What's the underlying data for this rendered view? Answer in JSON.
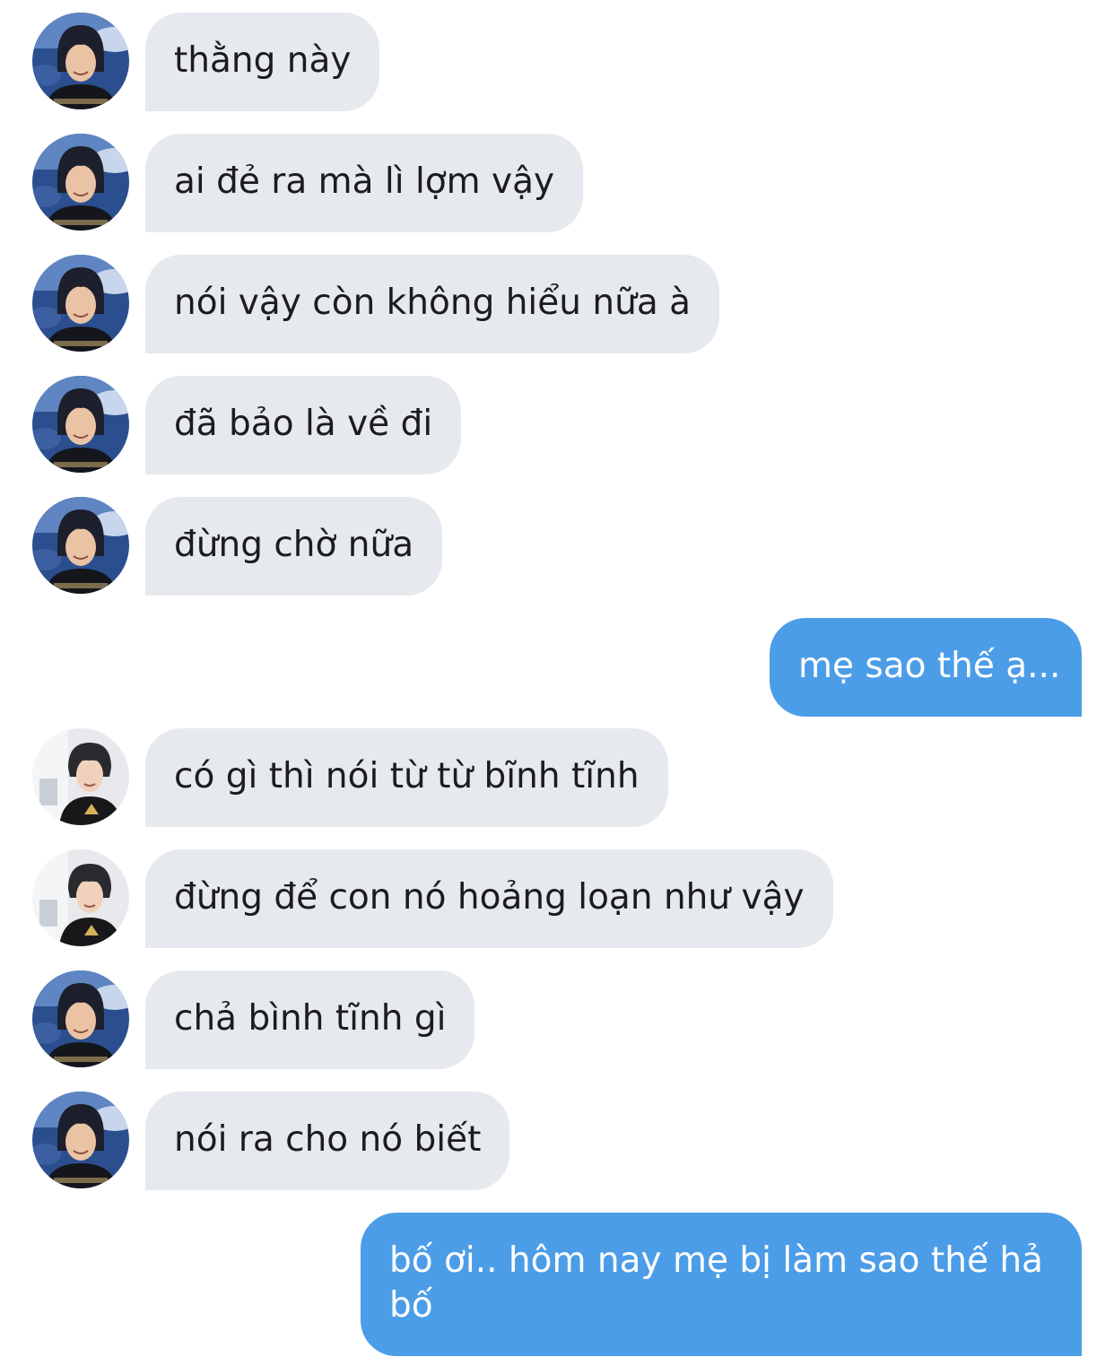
{
  "conversation": {
    "colors": {
      "incoming_bubble": "#e6e9ee",
      "outgoing_bubble": "#4c9de8",
      "incoming_text": "#1c1c1e",
      "outgoing_text": "#ffffff"
    },
    "messages": [
      {
        "direction": "incoming",
        "sender_avatar": "avatar-sky-background",
        "text": "thằng này"
      },
      {
        "direction": "incoming",
        "sender_avatar": "avatar-sky-background",
        "text": "ai đẻ ra mà lì lợm vậy"
      },
      {
        "direction": "incoming",
        "sender_avatar": "avatar-sky-background",
        "text": "nói vậy còn không hiểu nữa à"
      },
      {
        "direction": "incoming",
        "sender_avatar": "avatar-sky-background",
        "text": "đã bảo là về đi"
      },
      {
        "direction": "incoming",
        "sender_avatar": "avatar-sky-background",
        "text": "đừng chờ nữa"
      },
      {
        "direction": "outgoing",
        "text": "mẹ sao thế ạ..."
      },
      {
        "direction": "incoming",
        "sender_avatar": "avatar-white-room",
        "text": "có gì thì nói từ từ bĩnh tĩnh"
      },
      {
        "direction": "incoming",
        "sender_avatar": "avatar-white-room",
        "text": "đừng để con nó hoảng loạn như vậy"
      },
      {
        "direction": "incoming",
        "sender_avatar": "avatar-sky-background",
        "text": "chả bình tĩnh gì"
      },
      {
        "direction": "incoming",
        "sender_avatar": "avatar-sky-background",
        "text": "nói ra cho nó biết"
      },
      {
        "direction": "outgoing",
        "text": "bố ơi.. hôm nay mẹ bị làm sao thế hả bố"
      }
    ]
  }
}
